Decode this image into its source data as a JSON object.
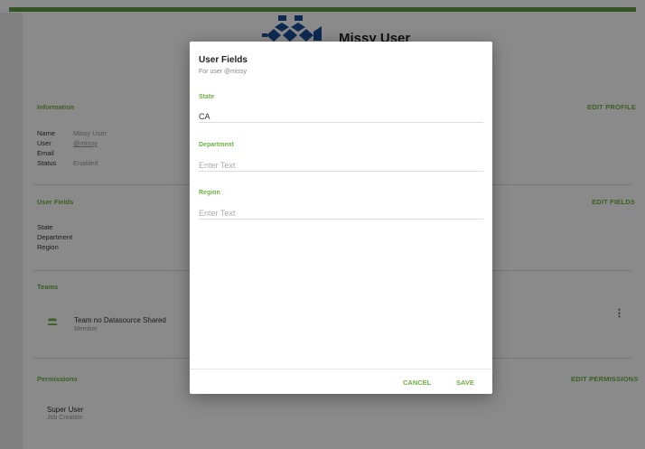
{
  "header": {
    "user_name": "Missy User"
  },
  "information": {
    "title": "Information",
    "action": "EDIT PROFILE",
    "rows": [
      {
        "key": "Name",
        "value": "Missy User"
      },
      {
        "key": "User",
        "value": "@missy"
      },
      {
        "key": "Email",
        "value": ""
      },
      {
        "key": "Status",
        "value": "Enabled"
      }
    ]
  },
  "user_fields": {
    "title": "User Fields",
    "action": "EDIT FIELDS",
    "rows": [
      {
        "key": "State"
      },
      {
        "key": "Department"
      },
      {
        "key": "Region"
      }
    ]
  },
  "teams": {
    "title": "Teams",
    "items": [
      {
        "name": "Team no Datasource Shared",
        "role": "Member",
        "icon": "group-icon"
      }
    ],
    "menu_glyph": "⋮"
  },
  "permissions": {
    "title": "Permissions",
    "action": "EDIT PERMISSIONS",
    "items": [
      {
        "name": "Super User",
        "sub": "Job Creation"
      }
    ]
  },
  "dialog": {
    "title": "User Fields",
    "subtitle": "For user @missy",
    "fields": [
      {
        "label": "State",
        "value": "CA",
        "placeholder": "Enter Text"
      },
      {
        "label": "Department",
        "value": "",
        "placeholder": "Enter Text"
      },
      {
        "label": "Region",
        "value": "",
        "placeholder": "Enter Text"
      }
    ],
    "cancel_label": "CANCEL",
    "save_label": "SAVE"
  },
  "colors": {
    "accent": "#6fb044",
    "topbar": "#5e9a3b",
    "logo": "#1a4e9a"
  }
}
